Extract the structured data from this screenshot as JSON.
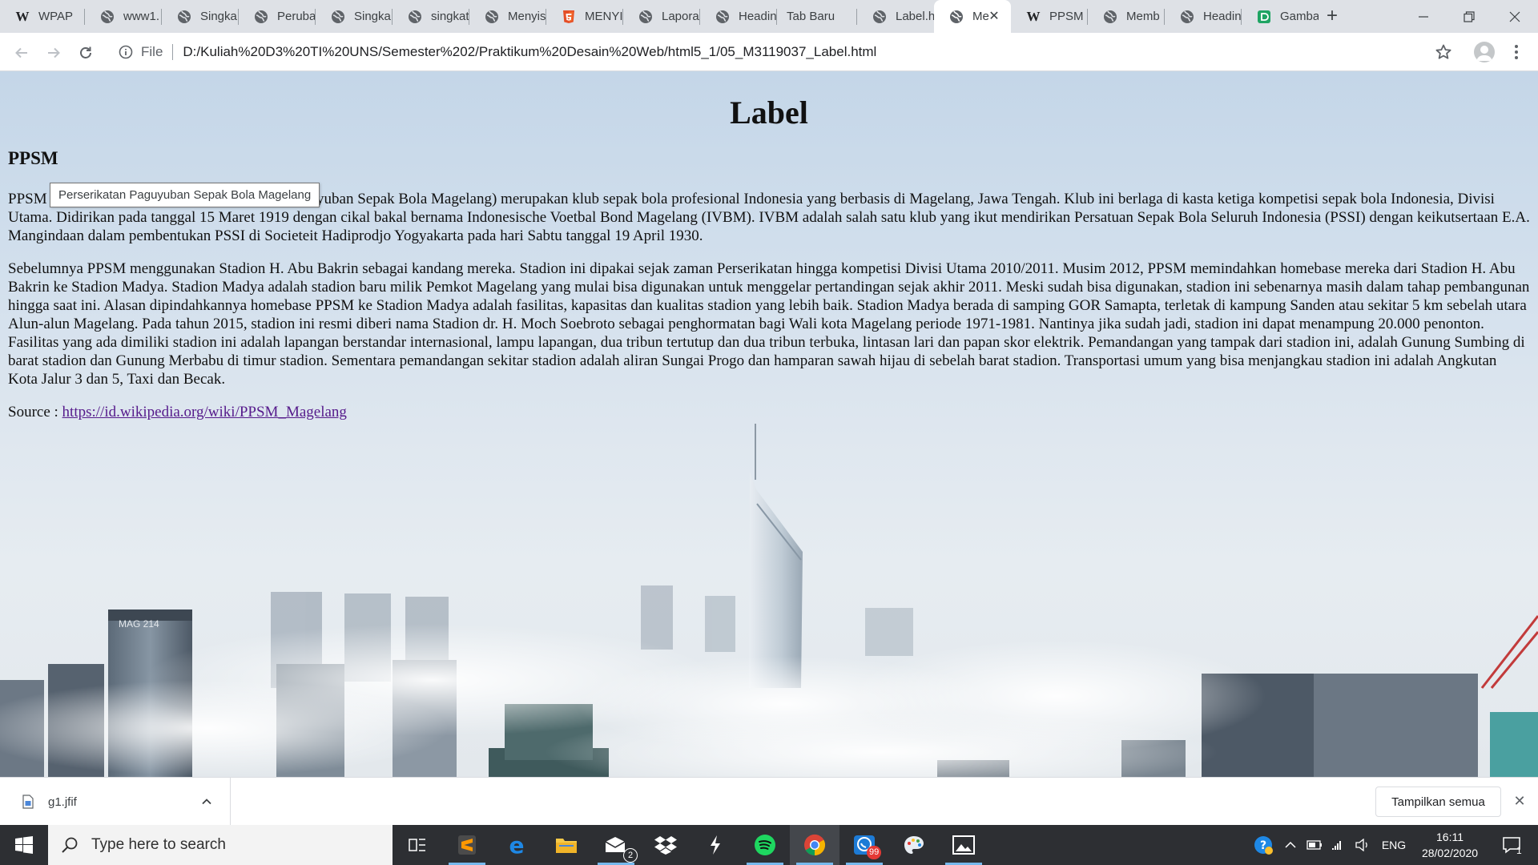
{
  "browser": {
    "tabs": [
      {
        "title": "WPAP",
        "icon": "wikipedia-icon"
      },
      {
        "title": "www1.",
        "icon": "globe-icon"
      },
      {
        "title": "Singka",
        "icon": "globe-icon"
      },
      {
        "title": "Peruba",
        "icon": "globe-icon"
      },
      {
        "title": "Singka",
        "icon": "globe-icon"
      },
      {
        "title": "singkat",
        "icon": "globe-icon"
      },
      {
        "title": "Menyis",
        "icon": "globe-icon"
      },
      {
        "title": "MENYI",
        "icon": "html5-icon"
      },
      {
        "title": "Lapora",
        "icon": "globe-icon"
      },
      {
        "title": "Headin",
        "icon": "globe-icon"
      },
      {
        "title": "Tab Baru",
        "icon": "none"
      },
      {
        "title": "Label.h",
        "icon": "globe-icon"
      },
      {
        "title": "Me",
        "icon": "globe-icon",
        "active": true
      },
      {
        "title": "PPSM",
        "icon": "wikipedia-icon"
      },
      {
        "title": "Memb",
        "icon": "globe-icon"
      },
      {
        "title": "Headin",
        "icon": "globe-icon"
      },
      {
        "title": "Gamba",
        "icon": "docs-icon"
      }
    ],
    "new_tab_label": "+",
    "address": {
      "scheme_label": "File",
      "url": "D:/Kuliah%20D3%20TI%20UNS/Semester%202/Praktikum%20Desain%20Web/html5_1/05_M3119037_Label.html"
    }
  },
  "page": {
    "title": "Label",
    "heading": "PPSM",
    "tooltip": "Perserikatan Paguyuban Sepak Bola Magelang",
    "para1_lead": "PPSM",
    "para1_rest": "atan Paguyuban Sepak Bola Magelang) merupakan klub sepak bola profesional Indonesia yang berbasis di Magelang, Jawa Tengah. Klub ini berlaga di kasta ketiga kompetisi sepak bola Indonesia, Divisi Utama. Didirikan pada tanggal 15 Maret 1919 dengan cikal bakal bernama Indonesische Voetbal Bond Magelang (IVBM). IVBM adalah salah satu klub yang ikut mendirikan Persatuan Sepak Bola Seluruh Indonesia (PSSI) dengan keikutsertaan E.A. Mangindaan dalam pembentukan PSSI di Societeit Hadiprodjo Yogyakarta pada hari Sabtu tanggal 19 April 1930.",
    "para2": "Sebelumnya PPSM menggunakan Stadion H. Abu Bakrin sebagai kandang mereka. Stadion ini dipakai sejak zaman Perserikatan hingga kompetisi Divisi Utama 2010/2011. Musim 2012, PPSM memindahkan homebase mereka dari Stadion H. Abu Bakrin ke Stadion Madya. Stadion Madya adalah stadion baru milik Pemkot Magelang yang mulai bisa digunakan untuk menggelar pertandingan sejak akhir 2011. Meski sudah bisa digunakan, stadion ini sebenarnya masih dalam tahap pembangunan hingga saat ini. Alasan dipindahkannya homebase PPSM ke Stadion Madya adalah fasilitas, kapasitas dan kualitas stadion yang lebih baik. Stadion Madya berada di samping GOR Samapta, terletak di kampung Sanden atau sekitar 5 km sebelah utara Alun-alun Magelang. Pada tahun 2015, stadion ini resmi diberi nama Stadion dr. H. Moch Soebroto sebagai penghormatan bagi Wali kota Magelang periode 1971-1981. Nantinya jika sudah jadi, stadion ini dapat menampung 20.000 penonton. Fasilitas yang ada dimiliki stadion ini adalah lapangan berstandar internasional, lampu lapangan, dua tribun tertutup dan dua tribun terbuka, lintasan lari dan papan skor elektrik. Pemandangan yang tampak dari stadion ini, adalah Gunung Sumbing di barat stadion dan Gunung Merbabu di timur stadion. Sementara pemandangan sekitar stadion adalah aliran Sungai Progo dan hamparan sawah hijau di sebelah barat stadion. Transportasi umum yang bisa menjangkau stadion ini adalah Angkutan Kota Jalur 3 dan 5, Taxi dan Becak.",
    "source_label": "Source : ",
    "source_link": "https://id.wikipedia.org/wiki/PPSM_Magelang",
    "building_sign": "MAG 214"
  },
  "downloads": {
    "file_name": "g1.jfif",
    "show_all_label": "Tampilkan semua"
  },
  "taskbar": {
    "search_placeholder": "Type here to search",
    "mail_badge": "2",
    "whatsapp_badge": "99",
    "language": "ENG",
    "time": "16:11",
    "date": "28/02/2020",
    "notification_count": "1"
  },
  "colors": {
    "link_visited": "#551a8b",
    "tab_strip": "#dee1e6",
    "taskbar": "#2d2f33",
    "running_indicator": "#76b9ed"
  }
}
